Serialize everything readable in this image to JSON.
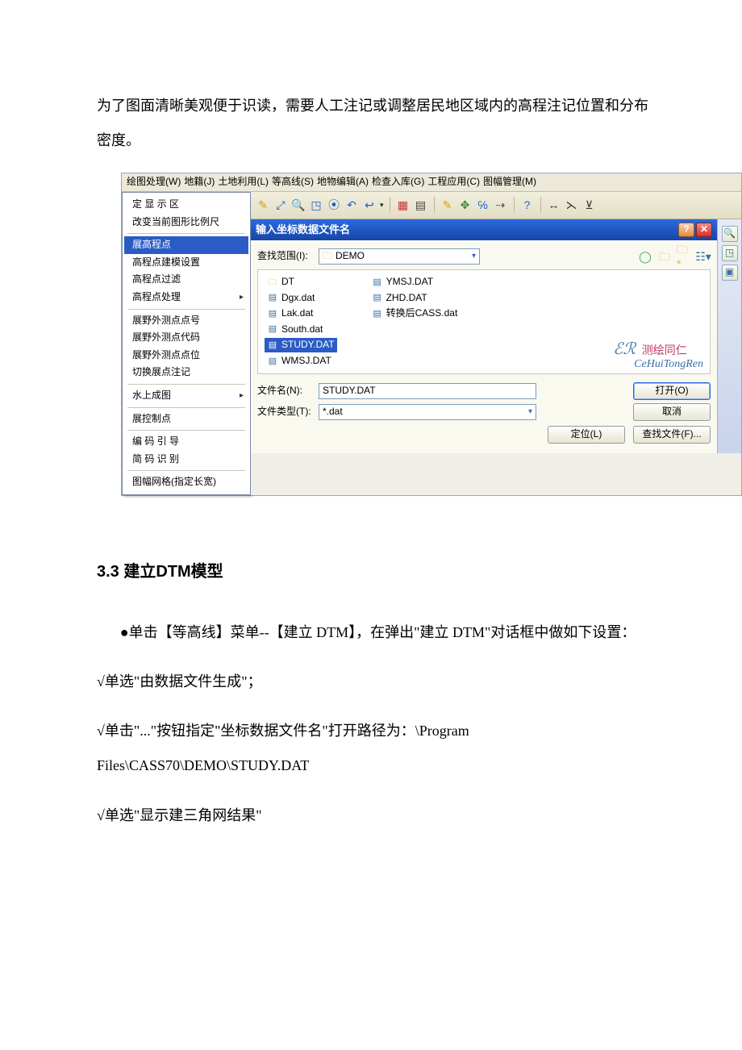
{
  "doc": {
    "para1": "为了图面清晰美观便于识读，需要人工注记或调整居民地区域内的高程注记位置和分布密度。",
    "section_title": "3.3 建立DTM模型",
    "para2": "●单击【等高线】菜单--【建立 DTM】，在弹出\"建立 DTM\"对话框中做如下设置：",
    "para3": "√单选\"由数据文件生成\"；",
    "para4": "√单击\"...\"按钮指定\"坐标数据文件名\"打开路径为：\\Program Files\\CASS70\\DEMO\\STUDY.DAT",
    "para5": "√单选\"显示建三角网结果\""
  },
  "menubar": {
    "items": [
      "绘图处理(W)",
      "地籍(J)",
      "土地利用(L)",
      "等高线(S)",
      "地物编辑(A)",
      "检查入库(G)",
      "工程应用(C)",
      "图幅管理(M)"
    ]
  },
  "dropdown": {
    "items": [
      {
        "label": "定 显 示 区"
      },
      {
        "label": "改变当前图形比例尺"
      },
      {
        "sep": true
      },
      {
        "label": "展高程点",
        "selected": true
      },
      {
        "label": "高程点建模设置"
      },
      {
        "label": "高程点过滤"
      },
      {
        "label": "高程点处理",
        "sub": true
      },
      {
        "sep": true
      },
      {
        "label": "展野外测点点号"
      },
      {
        "label": "展野外测点代码"
      },
      {
        "label": "展野外测点点位"
      },
      {
        "label": "切换展点注记"
      },
      {
        "sep": true
      },
      {
        "label": "水上成图",
        "sub": true
      },
      {
        "sep": true
      },
      {
        "label": "展控制点"
      },
      {
        "sep": true
      },
      {
        "label": "编 码 引 导"
      },
      {
        "label": "简 码 识 别"
      },
      {
        "sep": true
      },
      {
        "label": "图幅网格(指定长宽)"
      }
    ]
  },
  "dialog": {
    "title": "输入坐标数据文件名",
    "lookin_label": "查找范围(I):",
    "folder": "DEMO",
    "files_col1": [
      {
        "name": "DT",
        "folder": true
      },
      {
        "name": "Dgx.dat"
      },
      {
        "name": "Lak.dat"
      },
      {
        "name": "South.dat"
      },
      {
        "name": "STUDY.DAT",
        "selected": true
      },
      {
        "name": "WMSJ.DAT"
      }
    ],
    "files_col2": [
      {
        "name": "YMSJ.DAT"
      },
      {
        "name": "ZHD.DAT"
      },
      {
        "name": "转换后CASS.dat"
      }
    ],
    "filename_label": "文件名(N):",
    "filename_value": "STUDY.DAT",
    "filetype_label": "文件类型(T):",
    "filetype_value": "*.dat",
    "open_btn": "打开(O)",
    "cancel_btn": "取消",
    "locate_btn": "定位(L)",
    "find_btn": "查找文件(F)...",
    "watermark_cn": "测绘同仁",
    "watermark_en": "CeHuiTongRen"
  }
}
